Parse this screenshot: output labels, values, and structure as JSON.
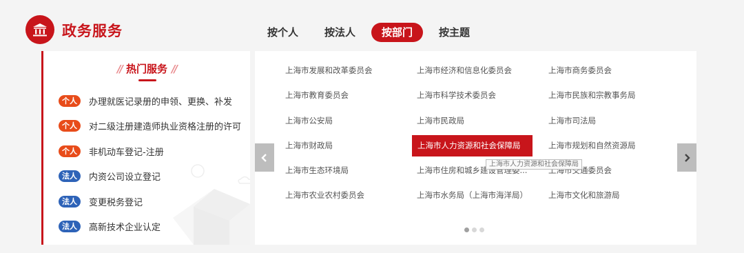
{
  "header": {
    "title": "政务服务",
    "icon": "government-building-icon",
    "accent_color": "#c8151b"
  },
  "tabs": [
    {
      "label": "按个人",
      "active": false
    },
    {
      "label": "按法人",
      "active": false
    },
    {
      "label": "按部门",
      "active": true
    },
    {
      "label": "按主题",
      "active": false
    }
  ],
  "hot_services": {
    "title": "热门服务",
    "items": [
      {
        "badge": "个人",
        "type": "person",
        "text": "办理就医记录册的申领、更换、补发"
      },
      {
        "badge": "个人",
        "type": "person",
        "text": "对二级注册建造师执业资格注册的许可"
      },
      {
        "badge": "个人",
        "type": "person",
        "text": "非机动车登记-注册"
      },
      {
        "badge": "法人",
        "type": "legal",
        "text": "内资公司设立登记"
      },
      {
        "badge": "法人",
        "type": "legal",
        "text": "变更税务登记"
      },
      {
        "badge": "法人",
        "type": "legal",
        "text": "高新技术企业认定"
      }
    ]
  },
  "departments": {
    "items": [
      "上海市发展和改革委员会",
      "上海市经济和信息化委员会",
      "上海市商务委员会",
      "上海市教育委员会",
      "上海市科学技术委员会",
      "上海市民族和宗教事务局",
      "上海市公安局",
      "上海市民政局",
      "上海市司法局",
      "上海市财政局",
      "上海市人力资源和社会保障局",
      "上海市规划和自然资源局",
      "上海市生态环境局",
      "上海市住房和城乡建设管理委...",
      "上海市交通委员会",
      "上海市农业农村委员会",
      "上海市水务局（上海市海洋局）",
      "上海市文化和旅游局"
    ],
    "selected": "上海市人力资源和社会保障局",
    "tooltip": "上海市人力资源和社会保障局",
    "page_count": 3,
    "current_page": 1
  }
}
